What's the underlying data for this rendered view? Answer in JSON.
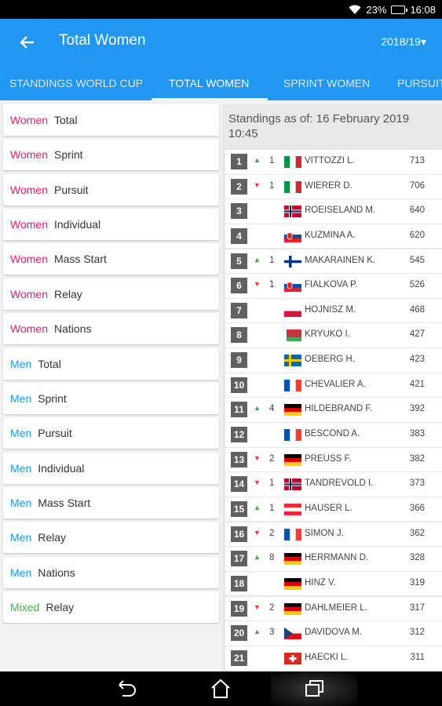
{
  "status": {
    "battery": "23%",
    "time": "16:08"
  },
  "appbar": {
    "title": "Total Women",
    "season": "2018/19▾"
  },
  "tabs": [
    {
      "label": "STANDINGS WORLD CUP"
    },
    {
      "label": "TOTAL WOMEN"
    },
    {
      "label": "SPRINT WOMEN"
    },
    {
      "label": "PURSUIT"
    }
  ],
  "colors": {
    "women": "#e91e63",
    "men": "#2196f3",
    "mixed": "#4caf50",
    "up": "#43a047",
    "down": "#e53935"
  },
  "categories": [
    {
      "group": "Women",
      "event": "Total",
      "type": "women"
    },
    {
      "group": "Women",
      "event": "Sprint",
      "type": "women"
    },
    {
      "group": "Women",
      "event": "Pursuit",
      "type": "women"
    },
    {
      "group": "Women",
      "event": "Individual",
      "type": "women"
    },
    {
      "group": "Women",
      "event": "Mass Start",
      "type": "women"
    },
    {
      "group": "Women",
      "event": "Relay",
      "type": "women"
    },
    {
      "group": "Women",
      "event": "Nations",
      "type": "women"
    },
    {
      "group": "Men",
      "event": "Total",
      "type": "men"
    },
    {
      "group": "Men",
      "event": "Sprint",
      "type": "men"
    },
    {
      "group": "Men",
      "event": "Pursuit",
      "type": "men"
    },
    {
      "group": "Men",
      "event": "Individual",
      "type": "men"
    },
    {
      "group": "Men",
      "event": "Mass Start",
      "type": "men"
    },
    {
      "group": "Men",
      "event": "Relay",
      "type": "men"
    },
    {
      "group": "Men",
      "event": "Nations",
      "type": "men"
    },
    {
      "group": "Mixed",
      "event": "Relay",
      "type": "mixed"
    }
  ],
  "standings": {
    "date_label": "Standings as of: 16 February 2019 10:45",
    "rows": [
      {
        "rank": "1",
        "trend": "up",
        "delta": "1",
        "flag": "ITA",
        "name": "VITTOZZI L.",
        "points": "713"
      },
      {
        "rank": "2",
        "trend": "down",
        "delta": "1",
        "flag": "ITA",
        "name": "WIERER D.",
        "points": "706"
      },
      {
        "rank": "3",
        "trend": "",
        "delta": "",
        "flag": "NOR",
        "name": "ROEISELAND M.",
        "points": "640"
      },
      {
        "rank": "4",
        "trend": "",
        "delta": "",
        "flag": "SVK",
        "name": "KUZMINA A.",
        "points": "620"
      },
      {
        "rank": "5",
        "trend": "up",
        "delta": "1",
        "flag": "FIN",
        "name": "MAKARAINEN K.",
        "points": "545"
      },
      {
        "rank": "6",
        "trend": "down",
        "delta": "1",
        "flag": "SVK",
        "name": "FIALKOVA P.",
        "points": "526"
      },
      {
        "rank": "7",
        "trend": "",
        "delta": "",
        "flag": "POL",
        "name": "HOJNISZ M.",
        "points": "468"
      },
      {
        "rank": "8",
        "trend": "",
        "delta": "",
        "flag": "BLR",
        "name": "KRYUKO I.",
        "points": "427"
      },
      {
        "rank": "9",
        "trend": "",
        "delta": "",
        "flag": "SWE",
        "name": "OEBERG H.",
        "points": "423"
      },
      {
        "rank": "10",
        "trend": "",
        "delta": "",
        "flag": "FRA",
        "name": "CHEVALIER A.",
        "points": "421"
      },
      {
        "rank": "11",
        "trend": "up",
        "delta": "4",
        "flag": "GER",
        "name": "HILDEBRAND F.",
        "points": "392"
      },
      {
        "rank": "12",
        "trend": "",
        "delta": "",
        "flag": "FRA",
        "name": "BESCOND A.",
        "points": "383"
      },
      {
        "rank": "13",
        "trend": "down",
        "delta": "2",
        "flag": "GER",
        "name": "PREUSS F.",
        "points": "382"
      },
      {
        "rank": "14",
        "trend": "down",
        "delta": "1",
        "flag": "NOR",
        "name": "TANDREVOLD I.",
        "points": "373"
      },
      {
        "rank": "15",
        "trend": "up",
        "delta": "1",
        "flag": "AUT",
        "name": "HAUSER L.",
        "points": "366"
      },
      {
        "rank": "16",
        "trend": "down",
        "delta": "2",
        "flag": "FRA",
        "name": "SIMON J.",
        "points": "362"
      },
      {
        "rank": "17",
        "trend": "up",
        "delta": "8",
        "flag": "GER",
        "name": "HERRMANN D.",
        "points": "328"
      },
      {
        "rank": "18",
        "trend": "",
        "delta": "",
        "flag": "GER",
        "name": "HINZ V.",
        "points": "319"
      },
      {
        "rank": "19",
        "trend": "down",
        "delta": "2",
        "flag": "GER",
        "name": "DAHLMEIER L.",
        "points": "317"
      },
      {
        "rank": "20",
        "trend": "up",
        "delta": "3",
        "flag": "CZE",
        "name": "DAVIDOVA M.",
        "points": "312"
      },
      {
        "rank": "21",
        "trend": "",
        "delta": "",
        "flag": "SUI",
        "name": "HAECKI L.",
        "points": "311"
      }
    ]
  }
}
